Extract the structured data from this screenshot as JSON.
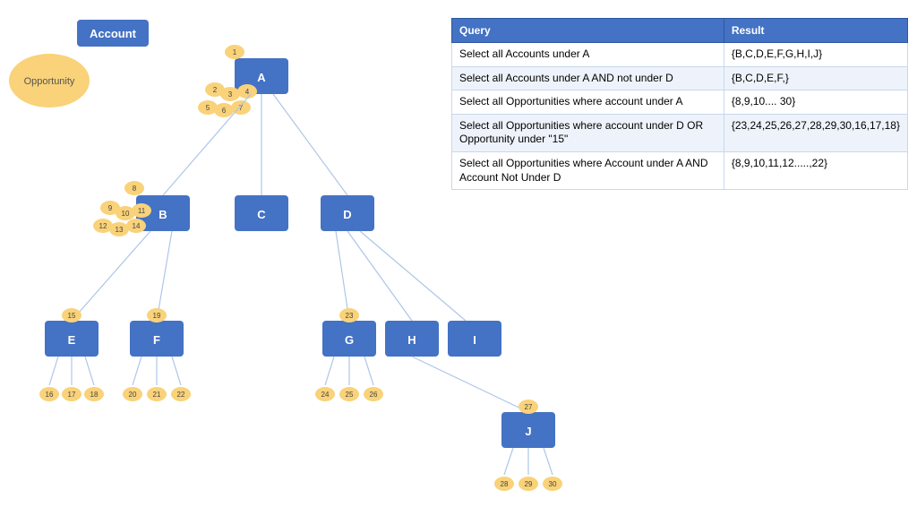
{
  "legend": {
    "account_label": "Account",
    "opportunity_label": "Opportunity"
  },
  "table": {
    "headers": [
      "Query",
      "Result"
    ],
    "rows": [
      {
        "query": "Select all Accounts under A",
        "result": "{B,C,D,E,F,G,H,I,J}"
      },
      {
        "query": "Select all Accounts under A AND not under D",
        "result": "{B,C,D,E,F,}"
      },
      {
        "query": "Select all Opportunities where account under A",
        "result": "{8,9,10.... 30}"
      },
      {
        "query": "Select all Opportunities where account under D OR Opportunity under \"15\"",
        "result": "{23,24,25,26,27,28,29,30,16,17,18}"
      },
      {
        "query": "Select all Opportunities where Account under A AND Account Not Under D",
        "result": "{8,9,10,11,12.....,22}"
      }
    ]
  }
}
